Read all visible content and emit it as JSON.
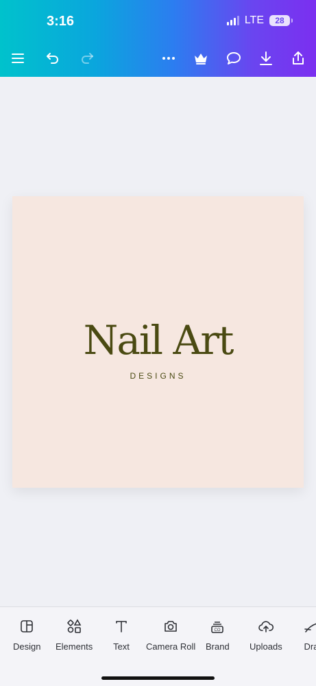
{
  "status_bar": {
    "time": "3:16",
    "network": "LTE",
    "battery": "28"
  },
  "toolbar": {
    "icons": [
      "menu-icon",
      "undo-icon",
      "redo-icon",
      "more-icon",
      "crown-icon",
      "comment-icon",
      "download-icon",
      "share-icon"
    ]
  },
  "design": {
    "title": "Nail Art",
    "subtitle": "DESIGNS",
    "background": "#f6e7e0",
    "text_color": "#4a4a12"
  },
  "bottom_nav": {
    "items": [
      {
        "label": "Design",
        "icon": "design-icon"
      },
      {
        "label": "Elements",
        "icon": "elements-icon"
      },
      {
        "label": "Text",
        "icon": "text-icon"
      },
      {
        "label": "Camera Roll",
        "icon": "camera-icon"
      },
      {
        "label": "Brand",
        "icon": "brand-icon"
      },
      {
        "label": "Uploads",
        "icon": "upload-cloud-icon"
      },
      {
        "label": "Dra",
        "icon": "draw-icon"
      }
    ]
  },
  "colors": {
    "accent_start": "#00c2cc",
    "accent_end": "#7b2ff0",
    "page_bg": "#eff0f5"
  }
}
